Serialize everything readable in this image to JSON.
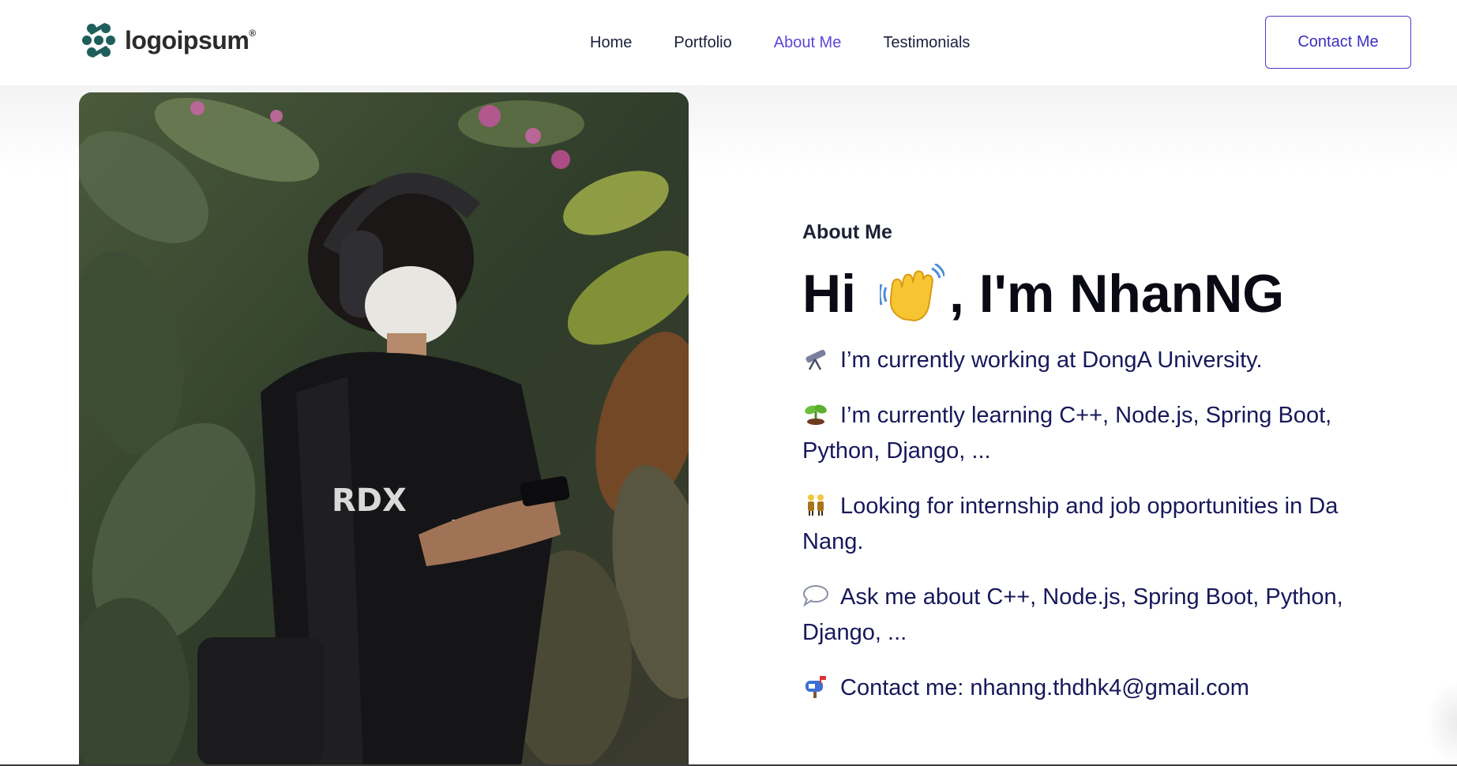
{
  "header": {
    "logo_text": "logoipsum",
    "logo_mark": "®",
    "nav": [
      {
        "label": "Home",
        "active": false
      },
      {
        "label": "Portfolio",
        "active": false
      },
      {
        "label": "About Me",
        "active": true
      },
      {
        "label": "Testimonials",
        "active": false
      }
    ],
    "contact_button": "Contact Me"
  },
  "about": {
    "label": "About Me",
    "greeting_start": "Hi",
    "greeting_end": ", I'm NhanNG",
    "wave_icon": "waving-hand-icon",
    "lines": [
      {
        "icon": "telescope-icon",
        "text": "I’m currently working at DongA University."
      },
      {
        "icon": "seedling-icon",
        "text": "I’m currently learning C++, Node.js, Spring Boot, Python, Django, ..."
      },
      {
        "icon": "people-icon",
        "text": "Looking for internship and job opportunities in Da Nang."
      },
      {
        "icon": "speech-bubble-icon",
        "text": "Ask me about C++, Node.js, Spring Boot, Python, Django, ..."
      },
      {
        "icon": "mailbox-icon",
        "text": "Contact me: nhanng.thdhk4@gmail.com"
      }
    ]
  },
  "colors": {
    "accent": "#5b46d9",
    "text_dark": "#17185a",
    "heading": "#0a0a14"
  }
}
